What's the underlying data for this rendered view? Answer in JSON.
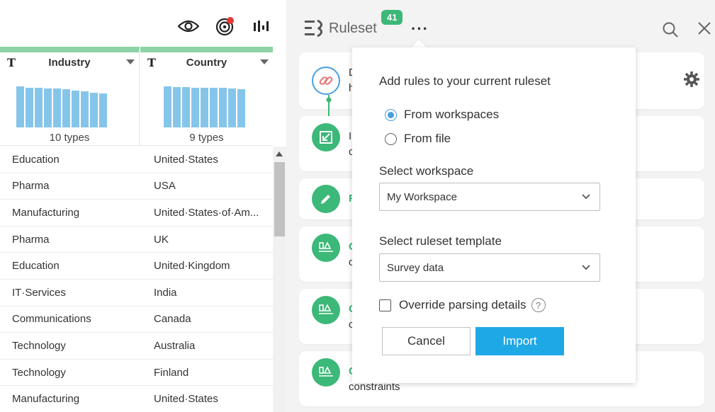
{
  "toolbar": {
    "icons": [
      "eye-icon",
      "target-icon",
      "waveform-icon"
    ],
    "notification_color": "#e53935"
  },
  "columns": [
    {
      "type_glyph": "T",
      "name": "Industry",
      "types_label": "10 types",
      "histogram": [
        1.0,
        0.97,
        0.97,
        0.95,
        0.95,
        0.93,
        0.9,
        0.88,
        0.85,
        0.82
      ]
    },
    {
      "type_glyph": "T",
      "name": "Country",
      "types_label": "9 types",
      "histogram": [
        1.0,
        0.98,
        0.98,
        0.97,
        0.96,
        0.96,
        0.96,
        0.95,
        0.93
      ]
    }
  ],
  "rows": [
    {
      "industry": "Education",
      "country": "United·States"
    },
    {
      "industry": "Pharma",
      "country": "USA"
    },
    {
      "industry": "Manufacturing",
      "country": "United·States·of·Am..."
    },
    {
      "industry": "Pharma",
      "country": "UK"
    },
    {
      "industry": "Education",
      "country": "United·Kingdom"
    },
    {
      "industry": "IT·Services",
      "country": "India"
    },
    {
      "industry": "Communications",
      "country": "Canada"
    },
    {
      "industry": "Technology",
      "country": "Australia"
    },
    {
      "industry": "Technology",
      "country": "Finland"
    },
    {
      "industry": "Manufacturing",
      "country": "United·States"
    }
  ],
  "ruleset": {
    "title": "Ruleset",
    "badge": "41",
    "more": "···",
    "cards": [
      {
        "letters": [
          "D",
          "h"
        ],
        "icon": "link-icon"
      },
      {
        "letters": [
          "I",
          "c"
        ],
        "icon": "import-arrow-icon"
      },
      {
        "letters": [
          "R"
        ],
        "icon": "pencil-icon"
      },
      {
        "letters": [
          "C",
          "c"
        ],
        "icon": "constraint-icon"
      },
      {
        "letters": [
          "C",
          "c"
        ],
        "icon": "constraint-icon"
      },
      {
        "letters": [
          "C",
          "constraints"
        ],
        "icon": "constraint-icon"
      }
    ],
    "accent": "#3cb878"
  },
  "popup": {
    "heading": "Add rules to your current ruleset",
    "source_options": [
      {
        "label": "From workspaces",
        "selected": true
      },
      {
        "label": "From file",
        "selected": false
      }
    ],
    "workspace_label": "Select workspace",
    "workspace_value": "My Workspace",
    "template_label": "Select ruleset template",
    "template_value": "Survey data",
    "override_label": "Override parsing details",
    "override_checked": false,
    "help_glyph": "?",
    "cancel_label": "Cancel",
    "import_label": "Import",
    "import_color": "#1fa8e6"
  }
}
